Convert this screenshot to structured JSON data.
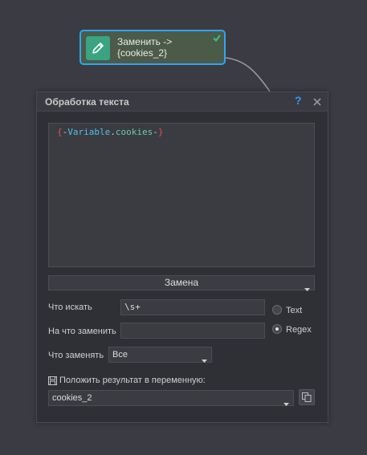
{
  "node": {
    "title_line1": "Заменить ->",
    "title_line2": "{cookies_2}",
    "icon": "pencil-icon",
    "status_icon": "check-icon",
    "accent": "#2ea6f0",
    "icon_bg": "#3aa381"
  },
  "dialog": {
    "title": "Обработка текста",
    "help_label": "?",
    "close_icon": "close-icon"
  },
  "editor": {
    "open": "{",
    "dash1": "-",
    "var": "Variable",
    "dot": ".",
    "name": "cookies",
    "dash2": "-",
    "close": "}"
  },
  "mode": {
    "selected": "Замена"
  },
  "form": {
    "search_label": "Что искать",
    "search_value": "\\s+",
    "replace_label": "На что заменить",
    "replace_value": "",
    "what_label": "Что заменять",
    "what_value": "Все",
    "radio_text": "Text",
    "radio_regex": "Regex",
    "radio_selected": "Regex",
    "save_label": "Положить результат в переменную:",
    "result_var": "cookies_2"
  }
}
